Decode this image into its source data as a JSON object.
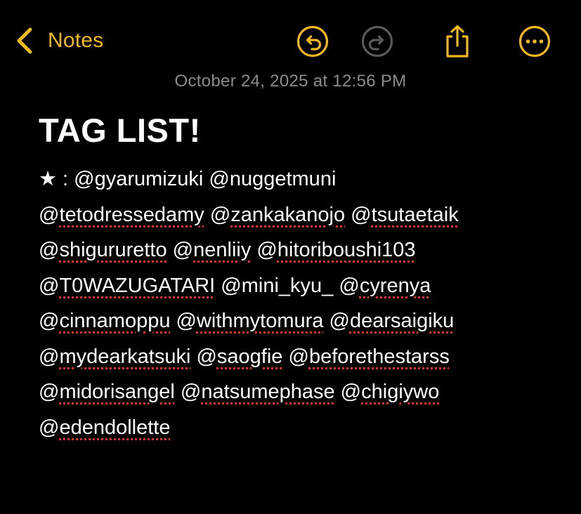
{
  "colors": {
    "accent": "#F2B81C",
    "disabled": "#5a5a5a",
    "background": "#000000",
    "text": "#ffffff",
    "timestamp": "#8c8c8c",
    "spellcheck": "#e0302a"
  },
  "nav": {
    "back_label": "Notes",
    "back_icon": "chevron-left-icon",
    "undo_icon": "undo-icon",
    "redo_icon": "redo-icon",
    "share_icon": "share-icon",
    "more_icon": "ellipsis-circle-icon"
  },
  "note": {
    "timestamp": "October 24, 2025 at 12:56 PM",
    "title": "TAG LIST!",
    "lines": [
      [
        {
          "text": "★ : ",
          "misspelled": false
        },
        {
          "text": "@gyarumizuki",
          "misspelled": false
        },
        {
          "text": " ",
          "misspelled": false
        },
        {
          "text": "@nuggetmuni",
          "misspelled": false
        }
      ],
      [
        {
          "text": "@",
          "misspelled": false
        },
        {
          "text": "tetodressedamy",
          "misspelled": true
        },
        {
          "text": " @",
          "misspelled": false
        },
        {
          "text": "zankakanojo",
          "misspelled": true
        },
        {
          "text": " @",
          "misspelled": false
        },
        {
          "text": "tsutaetaik",
          "misspelled": true
        }
      ],
      [
        {
          "text": "@",
          "misspelled": false
        },
        {
          "text": "shigururetto",
          "misspelled": true
        },
        {
          "text": " @",
          "misspelled": false
        },
        {
          "text": "nenliiy",
          "misspelled": true
        },
        {
          "text": " @",
          "misspelled": false
        },
        {
          "text": "hitoriboushi103",
          "misspelled": true
        }
      ],
      [
        {
          "text": "@",
          "misspelled": false
        },
        {
          "text": "T0WAZUGATARI",
          "misspelled": true
        },
        {
          "text": " @mini_kyu_ @",
          "misspelled": false
        },
        {
          "text": "cyrenya",
          "misspelled": true
        }
      ],
      [
        {
          "text": "@",
          "misspelled": false
        },
        {
          "text": "cinnamoppu",
          "misspelled": true
        },
        {
          "text": " @",
          "misspelled": false
        },
        {
          "text": "withmytomura",
          "misspelled": true
        },
        {
          "text": " @",
          "misspelled": false
        },
        {
          "text": "dearsaigiku",
          "misspelled": true
        }
      ],
      [
        {
          "text": "@",
          "misspelled": false
        },
        {
          "text": "mydearkatsuki",
          "misspelled": true
        },
        {
          "text": " @",
          "misspelled": false
        },
        {
          "text": "saogfie",
          "misspelled": true
        },
        {
          "text": " @",
          "misspelled": false
        },
        {
          "text": "beforethestarss",
          "misspelled": true
        }
      ],
      [
        {
          "text": "@",
          "misspelled": false
        },
        {
          "text": "midorisangel",
          "misspelled": true
        },
        {
          "text": " @",
          "misspelled": false
        },
        {
          "text": "natsumephase",
          "misspelled": true
        },
        {
          "text": " @",
          "misspelled": false
        },
        {
          "text": "chigiywo",
          "misspelled": true
        }
      ],
      [
        {
          "text": "@",
          "misspelled": false
        },
        {
          "text": "edendollette",
          "misspelled": true
        }
      ]
    ]
  }
}
